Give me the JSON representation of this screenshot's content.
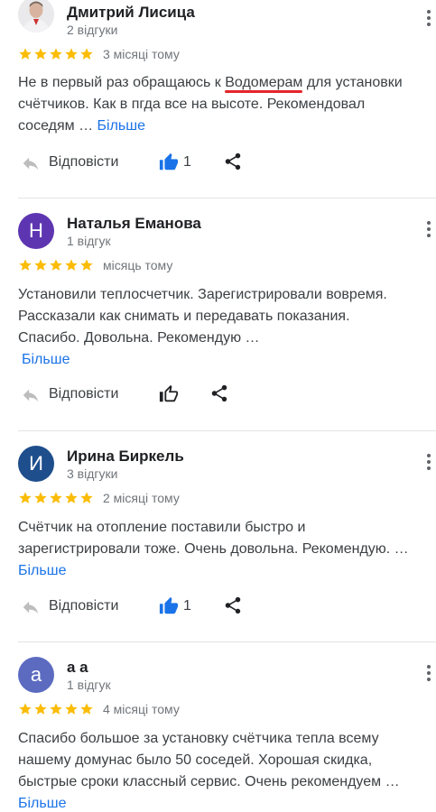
{
  "actions": {
    "reply_label": "Відповісти",
    "more_label": "Більше"
  },
  "colors": {
    "star": "#fbbc04",
    "link": "#1a73e8",
    "like_active": "#1a73e8",
    "highlight": "#e4252b"
  },
  "icons": {
    "reply": "reply-icon",
    "like": "thumb-up-icon",
    "share": "share-icon",
    "menu": "more-vert-icon",
    "star": "star-icon"
  },
  "reviews": [
    {
      "author": "Дмитрий Лисица",
      "review_count": "2 відгуки",
      "rating": 5,
      "date": "3 місяці тому",
      "text_before": "Не в первый раз обращаюсь к ",
      "text_highlight": "Водомерам",
      "text_after": " для установки счётчиков. Как в пгда все на высоте. Рекомендовал соседям … ",
      "likes": "1",
      "liked": true,
      "avatar_color": "#e9e9ea"
    },
    {
      "author": "Наталья Еманова",
      "review_count": "1 відгук",
      "rating": 5,
      "date": "місяць тому",
      "text": "Установили теплосчетчик. Зарегистрировали вовремя. Рассказали как снимать и передавать показания. Спасибо. Довольна. Рекомендую … ",
      "likes": "",
      "liked": false,
      "avatar_letter": "Н",
      "avatar_color": "#5e35b1"
    },
    {
      "author": "Ирина Биркель",
      "review_count": "3 відгуки",
      "rating": 5,
      "date": "2 місяці тому",
      "text": "Счётчик на отопление поставили быстро и зарегистрировали тоже. Очень довольна. Рекомендую. … ",
      "likes": "1",
      "liked": true,
      "avatar_letter": "И",
      "avatar_color": "#1e4e8c"
    },
    {
      "author": "а а",
      "review_count": "1 відгук",
      "rating": 5,
      "date": "4 місяці тому",
      "text": "Спасибо большое за установку счётчика тепла всему нашему домунас было 50 соседей. Хорошая скидка, быстрые сроки классный сервис. Очень рекомендуем … ",
      "likes": "",
      "liked": false,
      "avatar_letter": "а",
      "avatar_color": "#5c6bc0"
    }
  ]
}
